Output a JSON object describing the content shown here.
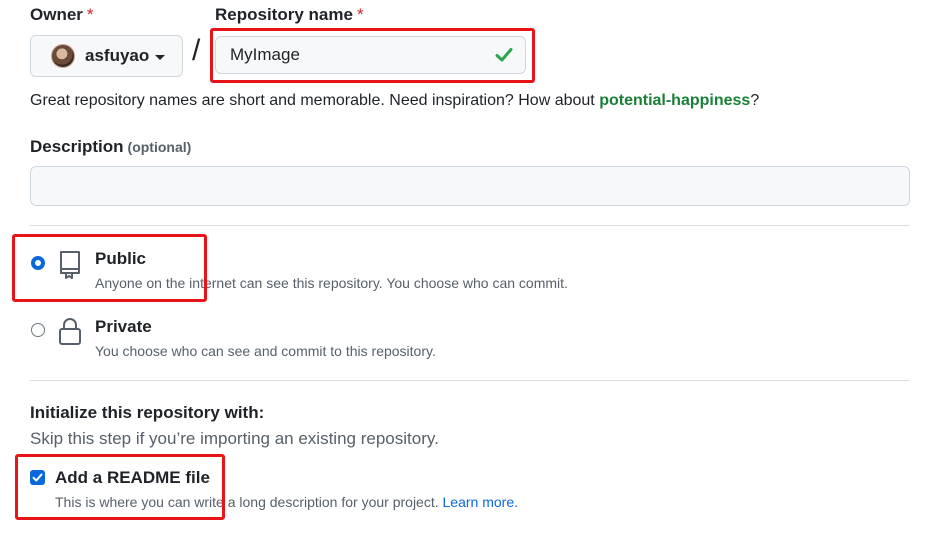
{
  "owner": {
    "label": "Owner",
    "required_mark": "*",
    "username": "asfuyao"
  },
  "repository_name": {
    "label": "Repository name",
    "required_mark": "*",
    "value": "MyImage",
    "status_icon": "check-icon"
  },
  "separator": "/",
  "name_hint": {
    "prefix": "Great repository names are short and memorable. Need inspiration? How about ",
    "suggestion": "potential-happiness",
    "suffix": "?"
  },
  "description": {
    "label": "Description",
    "optional": "(optional)",
    "value": ""
  },
  "visibility": {
    "options": [
      {
        "title": "Public",
        "description": "Anyone on the internet can see this repository. You choose who can commit.",
        "icon": "repo-icon",
        "selected": true
      },
      {
        "title": "Private",
        "description": "You choose who can see and commit to this repository.",
        "icon": "lock-icon",
        "selected": false
      }
    ]
  },
  "initialize": {
    "title": "Initialize this repository with:",
    "subtitle": "Skip this step if you’re importing an existing repository.",
    "readme": {
      "label": "Add a README file",
      "description": "This is where you can write a long description for your project. ",
      "link": "Learn more.",
      "checked": true
    }
  },
  "colors": {
    "accent": "#0969da",
    "success": "#1a7f37",
    "required": "#cf222e",
    "highlight": "#e8141a"
  }
}
